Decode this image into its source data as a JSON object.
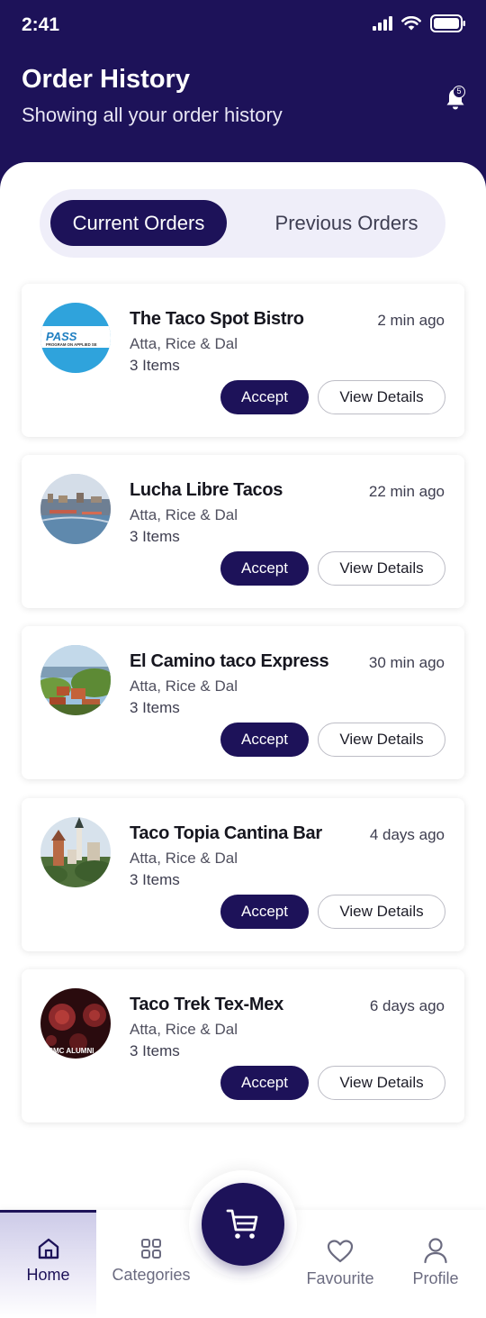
{
  "status_bar": {
    "time": "2:41"
  },
  "header": {
    "title": "Order History",
    "subtitle": "Showing all your order history",
    "notification_count": "5"
  },
  "tabs": [
    {
      "label": "Current Orders",
      "active": true
    },
    {
      "label": "Previous Orders",
      "active": false
    }
  ],
  "orders": [
    {
      "name": "The Taco Spot Bistro",
      "time_ago": "2 min ago",
      "description": "Atta, Rice & Dal",
      "items": "3 Items",
      "accept_label": "Accept",
      "details_label": "View Details",
      "avatar_text": "PASS",
      "avatar_subtext": "PROGRAM ON APPLIED SE"
    },
    {
      "name": "Lucha Libre Tacos",
      "time_ago": "22 min ago",
      "description": "Atta, Rice & Dal",
      "items": "3 Items",
      "accept_label": "Accept",
      "details_label": "View Details"
    },
    {
      "name": "El Camino taco Express",
      "time_ago": "30 min ago",
      "description": "Atta, Rice & Dal",
      "items": "3 Items",
      "accept_label": "Accept",
      "details_label": "View Details"
    },
    {
      "name": "Taco Topia Cantina Bar",
      "time_ago": "4 days ago",
      "description": "Atta, Rice & Dal",
      "items": "3 Items",
      "accept_label": "Accept",
      "details_label": "View Details"
    },
    {
      "name": "Taco Trek Tex-Mex",
      "time_ago": "6 days ago",
      "description": "Atta, Rice & Dal",
      "items": "3 Items",
      "accept_label": "Accept",
      "details_label": "View Details",
      "avatar_text": "9",
      "avatar_subtext": "GCMC ALUMNI"
    }
  ],
  "bottom_nav": {
    "home": "Home",
    "categories": "Categories",
    "favourite": "Favourite",
    "profile": "Profile"
  },
  "colors": {
    "primary": "#1d1259",
    "tab_bg": "#efeef9",
    "pass_blue": "#2fa3dc"
  }
}
